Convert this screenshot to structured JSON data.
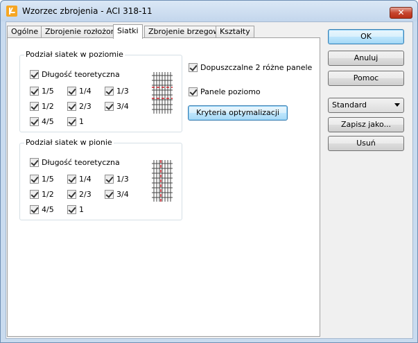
{
  "window": {
    "title": "Wzorzec zbrojenia - ACI 318-11",
    "close_label": "✕"
  },
  "tabs": [
    {
      "label": "Ogólne"
    },
    {
      "label": "Zbrojenie rozłożone"
    },
    {
      "label": "Siatki",
      "active": true
    },
    {
      "label": "Zbrojenie brzegowe"
    },
    {
      "label": "Kształty"
    }
  ],
  "horizontal": {
    "title": "Podział siatek w poziomie",
    "theoretical": {
      "label": "Długość teoretyczna",
      "checked": true
    },
    "fractions": [
      {
        "label": "1/5",
        "checked": true
      },
      {
        "label": "1/4",
        "checked": true
      },
      {
        "label": "1/3",
        "checked": true
      },
      {
        "label": "1/2",
        "checked": true
      },
      {
        "label": "2/3",
        "checked": true
      },
      {
        "label": "3/4",
        "checked": true
      },
      {
        "label": "4/5",
        "checked": true
      },
      {
        "label": "1",
        "checked": true
      }
    ]
  },
  "vertical": {
    "title": "Podział siatek w pionie",
    "theoretical": {
      "label": "Długość teoretyczna",
      "checked": true
    },
    "fractions": [
      {
        "label": "1/5",
        "checked": true
      },
      {
        "label": "1/4",
        "checked": true
      },
      {
        "label": "1/3",
        "checked": true
      },
      {
        "label": "1/2",
        "checked": true
      },
      {
        "label": "2/3",
        "checked": true
      },
      {
        "label": "3/4",
        "checked": true
      },
      {
        "label": "4/5",
        "checked": true
      },
      {
        "label": "1",
        "checked": true
      }
    ]
  },
  "options": {
    "two_panels": {
      "label": "Dopuszczalne 2 różne panele",
      "checked": true
    },
    "horizontal_panels": {
      "label": "Panele poziomo",
      "checked": true
    },
    "criteria_button": "Kryteria optymalizacji"
  },
  "side": {
    "ok": "OK",
    "cancel": "Anuluj",
    "help": "Pomoc",
    "template_value": "Standard",
    "save_as": "Zapisz jako...",
    "delete": "Usuń"
  },
  "colors": {
    "cut_line": "#d0202a",
    "mesh": "#444444"
  },
  "icons": {
    "app": "app-logo-icon",
    "dropdown": "chevron-down-icon"
  }
}
